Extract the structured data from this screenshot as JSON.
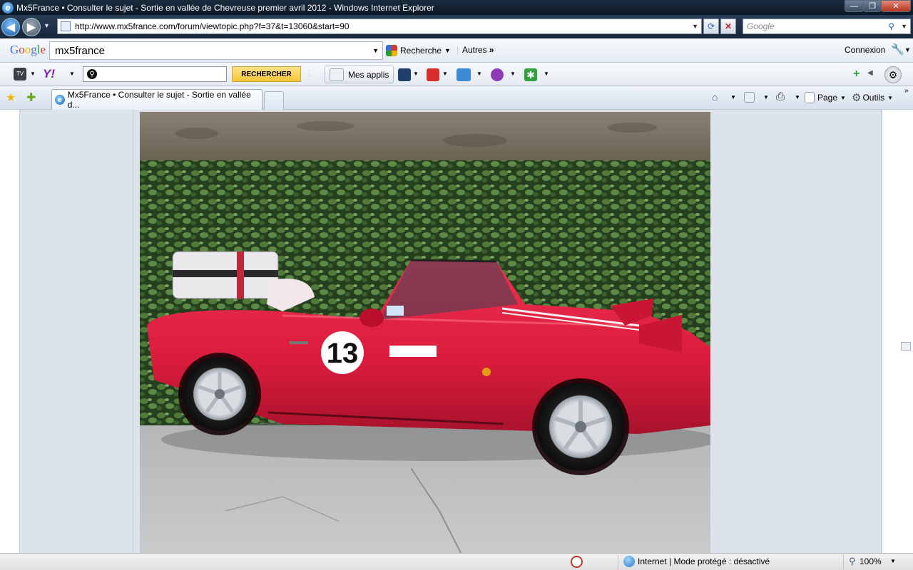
{
  "window": {
    "title": "Mx5France • Consulter le sujet - Sortie en vallée de Chevreuse premier avril 2012 - Windows Internet Explorer",
    "minimize": "—",
    "maximize": "❐",
    "close": "✕"
  },
  "address": {
    "url": "http://www.mx5france.com/forum/viewtopic.php?f=37&t=13060&start=90",
    "search_placeholder": "Google"
  },
  "google_toolbar": {
    "logo": "Google",
    "query": "mx5france",
    "search_label": "Recherche",
    "more_label": "Autres",
    "signin_label": "Connexion"
  },
  "yahoo_toolbar": {
    "search_button": "RECHERCHER",
    "apps_label": "Mes applis"
  },
  "tabs": [
    {
      "label": "Mx5France • Consulter le sujet - Sortie en vallée d..."
    }
  ],
  "command_bar": {
    "page_label": "Page",
    "tools_label": "Outils"
  },
  "content": {
    "race_number": "13"
  },
  "status": {
    "zone": "Internet | Mode protégé : désactivé",
    "zoom": "100%"
  },
  "colors": {
    "titlebar": "#0c1825",
    "car_red": "#d81b3c",
    "yahoo_button": "#f7c636"
  }
}
